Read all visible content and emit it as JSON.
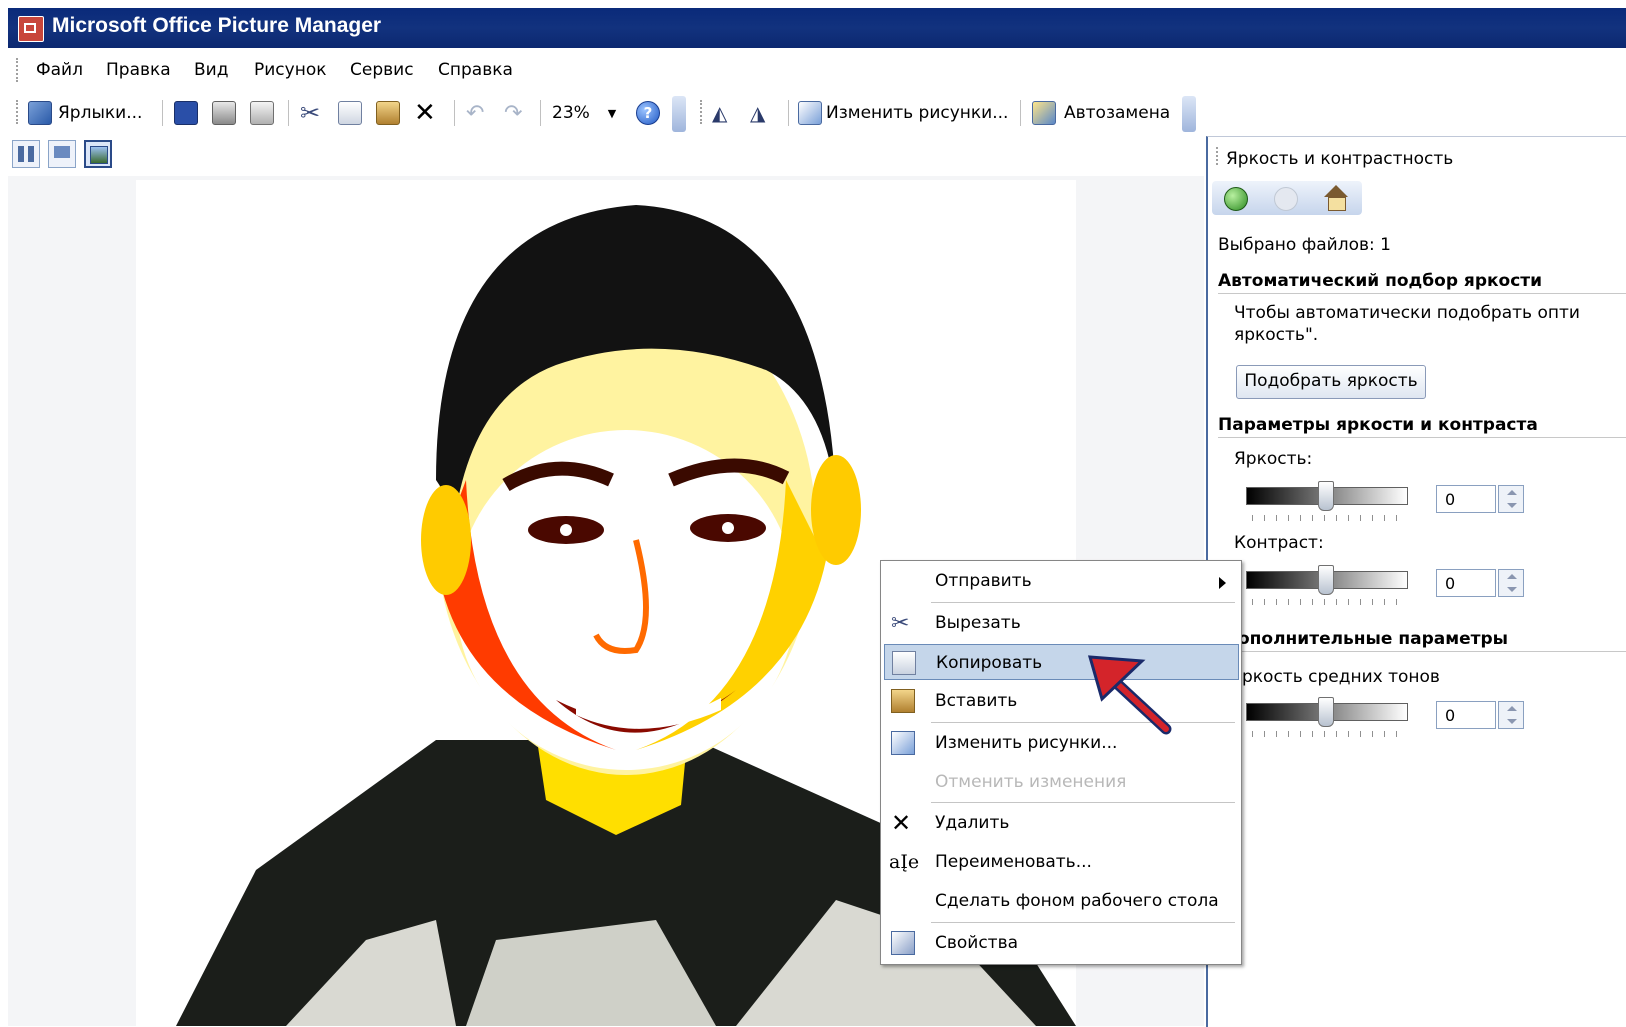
{
  "window": {
    "title": "Microsoft Office Picture Manager"
  },
  "menubar": {
    "items": [
      "Файл",
      "Правка",
      "Вид",
      "Рисунок",
      "Сервис",
      "Справка"
    ]
  },
  "toolbar": {
    "shortcuts_label": "Ярлыки...",
    "zoom_value": "23%",
    "edit_pictures_label": "Изменить рисунки...",
    "autocorrect_label": "Автозамена"
  },
  "taskpane": {
    "title": "Яркость и контрастность",
    "files_selected": "Выбрано файлов: 1",
    "auto_section_title": "Автоматический подбор яркости",
    "auto_desc_line1": "Чтобы автоматически подобрать опти",
    "auto_desc_line2": "яркость\".",
    "auto_button": "Подобрать яркость",
    "params_section_title": "Параметры яркости и контраста",
    "brightness_label": "Яркость:",
    "brightness_value": "0",
    "contrast_label": "Контраст:",
    "contrast_value": "0",
    "advanced_section_title": "ополнительные параметры",
    "midtones_label": "ркость средних тонов",
    "midtones_value": "0",
    "slider_levels": {
      "brightness": 0.5,
      "contrast": 0.5,
      "midtones": 0.5
    }
  },
  "context_menu": {
    "items": [
      {
        "label": "Отправить",
        "icon": "send-icon",
        "has_submenu": true
      },
      {
        "label": "Вырезать",
        "icon": "scissors-icon"
      },
      {
        "label": "Копировать",
        "icon": "copy-icon",
        "selected": true
      },
      {
        "label": "Вставить",
        "icon": "paste-icon"
      },
      {
        "label": "Изменить рисунки...",
        "icon": "edit-pictures-icon"
      },
      {
        "label": "Отменить изменения",
        "icon": "",
        "disabled": true
      },
      {
        "label": "Удалить",
        "icon": "delete-x-icon"
      },
      {
        "label": "Переименовать...",
        "icon": "rename-icon"
      },
      {
        "label": "Сделать фоном рабочего стола",
        "icon": ""
      },
      {
        "label": "Свойства",
        "icon": "properties-icon"
      }
    ]
  },
  "colors": {
    "titlebar": "#12327e",
    "selection": "#c5d6ea",
    "arrow": "#d4242a"
  }
}
